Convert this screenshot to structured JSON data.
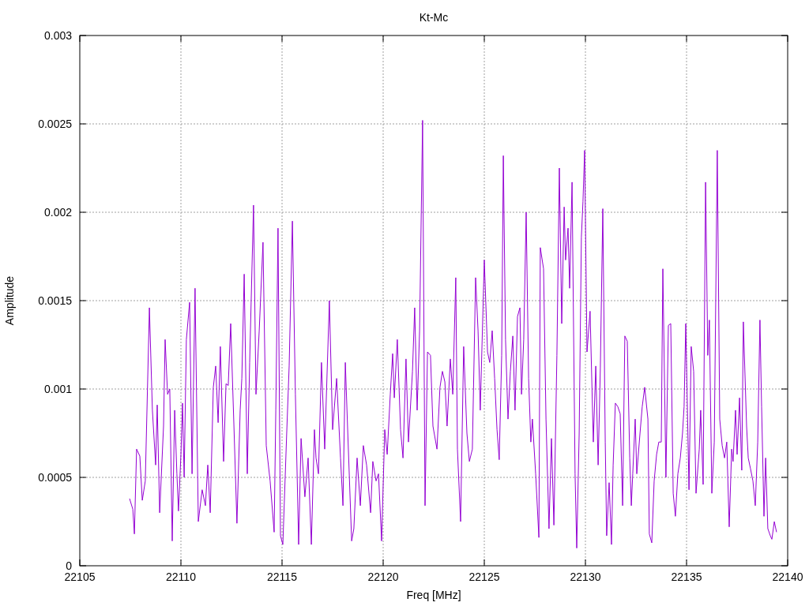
{
  "chart_data": {
    "type": "line",
    "grid": true,
    "title": "Kt-Mc",
    "xlabel": "Freq [MHz]",
    "ylabel": "Amplitude",
    "xlim": [
      22105,
      22140
    ],
    "ylim": [
      0,
      0.003
    ],
    "xticks": [
      22105,
      22110,
      22115,
      22120,
      22125,
      22130,
      22135,
      22140
    ],
    "yticks": [
      0,
      0.0005,
      0.001,
      0.0015,
      0.002,
      0.0025,
      0.003
    ],
    "x": [
      22107.46,
      22107.62,
      22107.7,
      22107.81,
      22107.97,
      22108.09,
      22108.24,
      22108.44,
      22108.59,
      22108.75,
      22108.83,
      22108.95,
      22109.14,
      22109.22,
      22109.34,
      22109.45,
      22109.57,
      22109.69,
      22109.8,
      22109.88,
      22110,
      22110.08,
      22110.16,
      22110.27,
      22110.43,
      22110.55,
      22110.7,
      22110.86,
      22111.05,
      22111.21,
      22111.33,
      22111.45,
      22111.6,
      22111.72,
      22111.84,
      22111.95,
      22112.11,
      22112.23,
      22112.34,
      22112.46,
      22112.62,
      22112.77,
      22112.93,
      22113.01,
      22113.13,
      22113.28,
      22113.4,
      22113.59,
      22113.71,
      22113.87,
      22114.06,
      22114.22,
      22114.41,
      22114.61,
      22114.69,
      22114.8,
      22114.92,
      22115.04,
      22115.23,
      22115.35,
      22115.51,
      22115.66,
      22115.82,
      22115.94,
      22116.13,
      22116.29,
      22116.45,
      22116.6,
      22116.68,
      22116.8,
      22116.95,
      22117.11,
      22117.34,
      22117.5,
      22117.7,
      22117.89,
      22118.01,
      22118.13,
      22118.24,
      22118.44,
      22118.55,
      22118.71,
      22118.87,
      22119.02,
      22119.18,
      22119.38,
      22119.49,
      22119.65,
      22119.77,
      22119.92,
      22120.08,
      22120.2,
      22120.35,
      22120.47,
      22120.55,
      22120.7,
      22120.86,
      22120.98,
      22121.13,
      22121.25,
      22121.45,
      22121.56,
      22121.68,
      22121.8,
      22121.95,
      22122.07,
      22122.19,
      22122.34,
      22122.46,
      22122.66,
      22122.81,
      22122.93,
      22123.05,
      22123.16,
      22123.32,
      22123.44,
      22123.59,
      22123.67,
      22123.83,
      22123.98,
      22124.14,
      22124.26,
      22124.41,
      22124.57,
      22124.69,
      22124.8,
      22125,
      22125.16,
      22125.27,
      22125.39,
      22125.51,
      22125.63,
      22125.74,
      22125.86,
      22125.94,
      22126.05,
      22126.17,
      22126.29,
      22126.41,
      22126.52,
      22126.64,
      22126.76,
      22126.84,
      22126.95,
      22127.07,
      22127.19,
      22127.3,
      22127.38,
      22127.54,
      22127.7,
      22127.77,
      22127.93,
      22128.05,
      22128.2,
      22128.32,
      22128.44,
      22128.59,
      22128.71,
      22128.83,
      22128.95,
      22129.02,
      22129.14,
      22129.22,
      22129.34,
      22129.49,
      22129.57,
      22129.69,
      22129.8,
      22129.88,
      22129.96,
      22130.08,
      22130.23,
      22130.39,
      22130.51,
      22130.63,
      22130.74,
      22130.86,
      22130.98,
      22131.05,
      22131.17,
      22131.29,
      22131.37,
      22131.48,
      22131.6,
      22131.72,
      22131.84,
      22131.95,
      22132.07,
      22132.19,
      22132.27,
      22132.34,
      22132.46,
      22132.54,
      22132.7,
      22132.81,
      22132.93,
      22133.09,
      22133.16,
      22133.28,
      22133.4,
      22133.52,
      22133.63,
      22133.75,
      22133.83,
      22133.98,
      22134.1,
      22134.22,
      22134.34,
      22134.45,
      22134.57,
      22134.69,
      22134.8,
      22134.88,
      22134.96,
      22135.12,
      22135.23,
      22135.35,
      22135.47,
      22135.63,
      22135.7,
      22135.82,
      22135.94,
      22136.05,
      22136.13,
      22136.25,
      22136.37,
      22136.52,
      22136.64,
      22136.76,
      22136.88,
      22136.99,
      22137.11,
      22137.23,
      22137.3,
      22137.42,
      22137.5,
      22137.62,
      22137.73,
      22137.81,
      22137.97,
      22138.05,
      22138.16,
      22138.28,
      22138.4,
      22138.52,
      22138.63,
      22138.71,
      22138.83,
      22138.91,
      22139.02,
      22139.14,
      22139.22,
      22139.34,
      22139.45
    ],
    "series": [
      {
        "color": "#9400d3",
        "values": [
          0.00038,
          0.00032,
          0.00018,
          0.00066,
          0.00062,
          0.00037,
          0.00048,
          0.00146,
          0.00088,
          0.00057,
          0.00091,
          0.0003,
          0.00079,
          0.00128,
          0.00097,
          0.001,
          0.00014,
          0.00088,
          0.00052,
          0.00031,
          0.00063,
          0.00092,
          0.0005,
          0.00128,
          0.00149,
          0.00052,
          0.00157,
          0.00025,
          0.00043,
          0.00034,
          0.00057,
          0.0003,
          0.00101,
          0.00113,
          0.00081,
          0.00124,
          0.00059,
          0.00103,
          0.00102,
          0.00137,
          0.00079,
          0.00024,
          0.00088,
          0.00106,
          0.00165,
          0.00052,
          0.00115,
          0.00204,
          0.00097,
          0.00133,
          0.00183,
          0.00068,
          0.00048,
          0.00019,
          0.00088,
          0.00191,
          0.00017,
          0.00012,
          0.00075,
          0.00113,
          0.00195,
          0.00097,
          0.00012,
          0.00072,
          0.00039,
          0.00061,
          0.00012,
          0.00077,
          0.00061,
          0.00052,
          0.00115,
          0.00066,
          0.0015,
          0.00077,
          0.00106,
          0.00061,
          0.00034,
          0.00115,
          0.00079,
          0.00014,
          0.00021,
          0.00061,
          0.00034,
          0.00068,
          0.00057,
          0.0003,
          0.00059,
          0.00048,
          0.00052,
          0.00014,
          0.00077,
          0.00063,
          0.00097,
          0.0012,
          0.00095,
          0.00128,
          0.00077,
          0.00061,
          0.00117,
          0.0007,
          0.0011,
          0.00146,
          0.00088,
          0.00133,
          0.00252,
          0.00034,
          0.00121,
          0.00119,
          0.00079,
          0.00066,
          0.00101,
          0.0011,
          0.00104,
          0.00079,
          0.00117,
          0.00097,
          0.00163,
          0.00066,
          0.00025,
          0.00124,
          0.00075,
          0.00059,
          0.00066,
          0.00163,
          0.00133,
          0.00088,
          0.00173,
          0.00121,
          0.00115,
          0.00133,
          0.00106,
          0.00077,
          0.0006,
          0.00119,
          0.00232,
          0.00128,
          0.00083,
          0.0011,
          0.0013,
          0.00088,
          0.00141,
          0.00146,
          0.00097,
          0.00128,
          0.002,
          0.00106,
          0.0007,
          0.00083,
          0.00052,
          0.00016,
          0.0018,
          0.00168,
          0.00083,
          0.00021,
          0.00072,
          0.00023,
          0.00119,
          0.00225,
          0.00137,
          0.00203,
          0.00173,
          0.00191,
          0.00157,
          0.00217,
          0.00052,
          0.0001,
          0.00075,
          0.00186,
          0.00206,
          0.00235,
          0.00121,
          0.00144,
          0.0007,
          0.00113,
          0.00057,
          0.00112,
          0.00202,
          0.0007,
          0.00017,
          0.00047,
          0.00012,
          0.00057,
          0.00092,
          0.0009,
          0.00086,
          0.00034,
          0.0013,
          0.00127,
          0.00061,
          0.00034,
          0.00052,
          0.00083,
          0.00052,
          0.00075,
          0.0009,
          0.00101,
          0.00083,
          0.00018,
          0.00013,
          0.00048,
          0.00063,
          0.0007,
          0.0007,
          0.00168,
          0.0005,
          0.00136,
          0.00137,
          0.00041,
          0.00028,
          0.00052,
          0.00061,
          0.00075,
          0.0009,
          0.00137,
          0.00043,
          0.00124,
          0.0011,
          0.00041,
          0.00066,
          0.00088,
          0.00046,
          0.00217,
          0.00119,
          0.00139,
          0.00041,
          0.0007,
          0.00235,
          0.00083,
          0.00068,
          0.00061,
          0.0007,
          0.00022,
          0.00066,
          0.00059,
          0.00088,
          0.00063,
          0.00095,
          0.00054,
          0.00138,
          0.00079,
          0.00061,
          0.00055,
          0.00048,
          0.00034,
          0.0007,
          0.00139,
          0.0009,
          0.00028,
          0.00061,
          0.00021,
          0.00017,
          0.00015,
          0.00025,
          0.00019
        ]
      }
    ]
  }
}
